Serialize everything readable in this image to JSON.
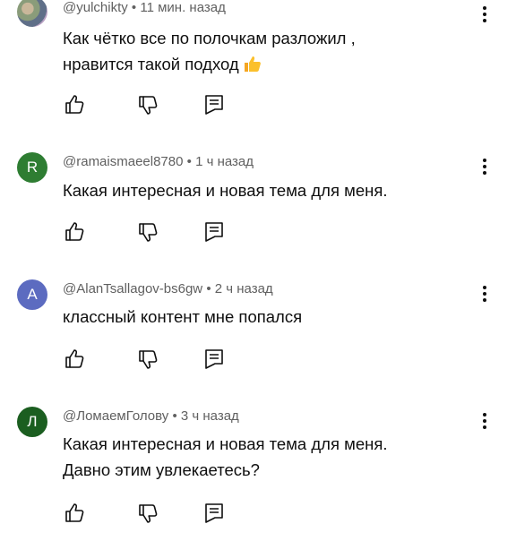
{
  "comments": [
    {
      "author": "@yulchikty",
      "time": "11 мин. назад",
      "avatar_letter": "",
      "avatar_color": "",
      "text": "Как чётко все по полочкам разложил ,\nнравится такой подход"
    },
    {
      "author": "@ramaismaeel8780",
      "time": "1 ч назад",
      "avatar_letter": "R",
      "avatar_color": "#2e7d32",
      "text": "Какая интересная и новая тема для меня."
    },
    {
      "author": "@AlanTsallagov-bs6gw",
      "time": "2 ч назад",
      "avatar_letter": "A",
      "avatar_color": "#5c6bc0",
      "text": "классный контент мне попался"
    },
    {
      "author": "@ЛомаемГолову",
      "time": "3 ч назад",
      "avatar_letter": "Л",
      "avatar_color": "#1b5e20",
      "text": "Какая интересная и новая тема для меня.\nДавно этим увлекаетесь?"
    }
  ],
  "meta_separator": "•",
  "icons": {
    "like": "thumb-up-icon",
    "dislike": "thumb-down-icon",
    "reply": "reply-icon",
    "menu": "more-vert-icon",
    "emoji": "thumbs-up-emoji"
  }
}
